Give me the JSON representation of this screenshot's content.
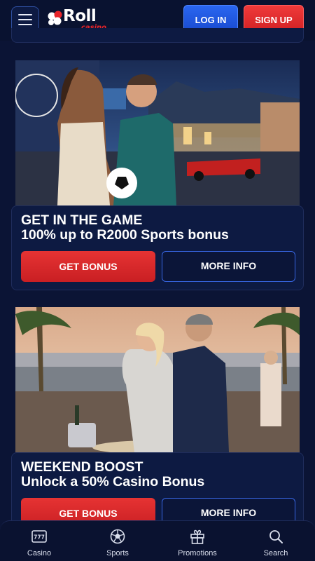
{
  "header": {
    "logo_text": "Roll",
    "logo_sub": "casino",
    "login_label": "LOG IN",
    "signup_label": "SIGN UP"
  },
  "promos": [
    {
      "title": "GET IN THE GAME",
      "subtitle": "100% up to R2000 Sports bonus",
      "primary_label": "GET BONUS",
      "secondary_label": "MORE INFO"
    },
    {
      "title": "WEEKEND BOOST",
      "subtitle": "Unlock a 50% Casino Bonus",
      "primary_label": "GET BONUS",
      "secondary_label": "MORE INFO"
    }
  ],
  "bottom_nav": [
    {
      "label": "Casino",
      "icon": "slot-machine-icon"
    },
    {
      "label": "Sports",
      "icon": "soccer-ball-icon"
    },
    {
      "label": "Promotions",
      "icon": "gift-icon"
    },
    {
      "label": "Search",
      "icon": "search-icon"
    }
  ],
  "colors": {
    "background": "#0b1435",
    "card": "#0d1a42",
    "primary_red": "#d8262a",
    "accent_blue": "#2a66f0"
  }
}
